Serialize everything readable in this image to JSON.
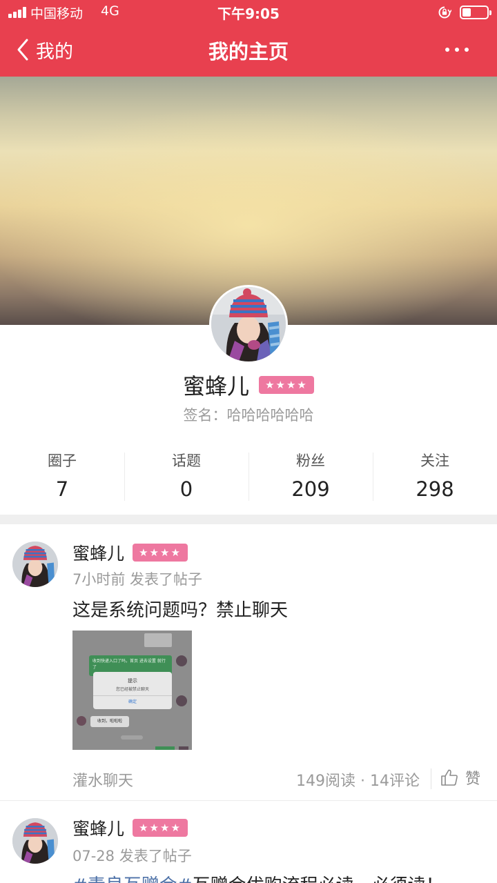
{
  "status_bar": {
    "carrier": "中国移动",
    "network": "4G",
    "time": "下午9:05"
  },
  "nav": {
    "back_label": "我的",
    "title": "我的主页"
  },
  "profile": {
    "name": "蜜蜂儿",
    "level_stars": "★★★★",
    "signature": "签名：哈哈哈哈哈哈"
  },
  "stats": [
    {
      "label": "圈子",
      "value": "7"
    },
    {
      "label": "话题",
      "value": "0"
    },
    {
      "label": "粉丝",
      "value": "209"
    },
    {
      "label": "关注",
      "value": "298"
    }
  ],
  "posts": [
    {
      "author": "蜜蜂儿",
      "level_stars": "★★★★",
      "meta": "7小时前 发表了帖子",
      "text": "这是系统问题吗？禁止聊天",
      "category": "灌水聊天",
      "reads": "149阅读 · 14评论",
      "like_label": "赞",
      "image": {
        "chat_msg_1": "收到快递入口了吗，首页 进去设置 就行了",
        "dialog_title": "提示",
        "dialog_body": "您已经被禁止聊天",
        "dialog_button": "确定",
        "chat_msg_2": "收到，啦啦啦"
      }
    },
    {
      "author": "蜜蜂儿",
      "level_stars": "★★★★",
      "meta": "07-28 发表了帖子",
      "text_tag": "#素良互赠会#",
      "text_rest": "互赠会优购流程必读，必须读！"
    }
  ],
  "colors": {
    "brand": "#e8404f",
    "badge": "#ee78a0",
    "muted_text": "#9a9a9a",
    "tag_blue": "#4e72a8"
  },
  "icons": [
    "signal-icon",
    "lock-rotation-icon",
    "battery-icon",
    "chevron-left-icon",
    "more-dots-icon",
    "thumbs-up-icon"
  ]
}
